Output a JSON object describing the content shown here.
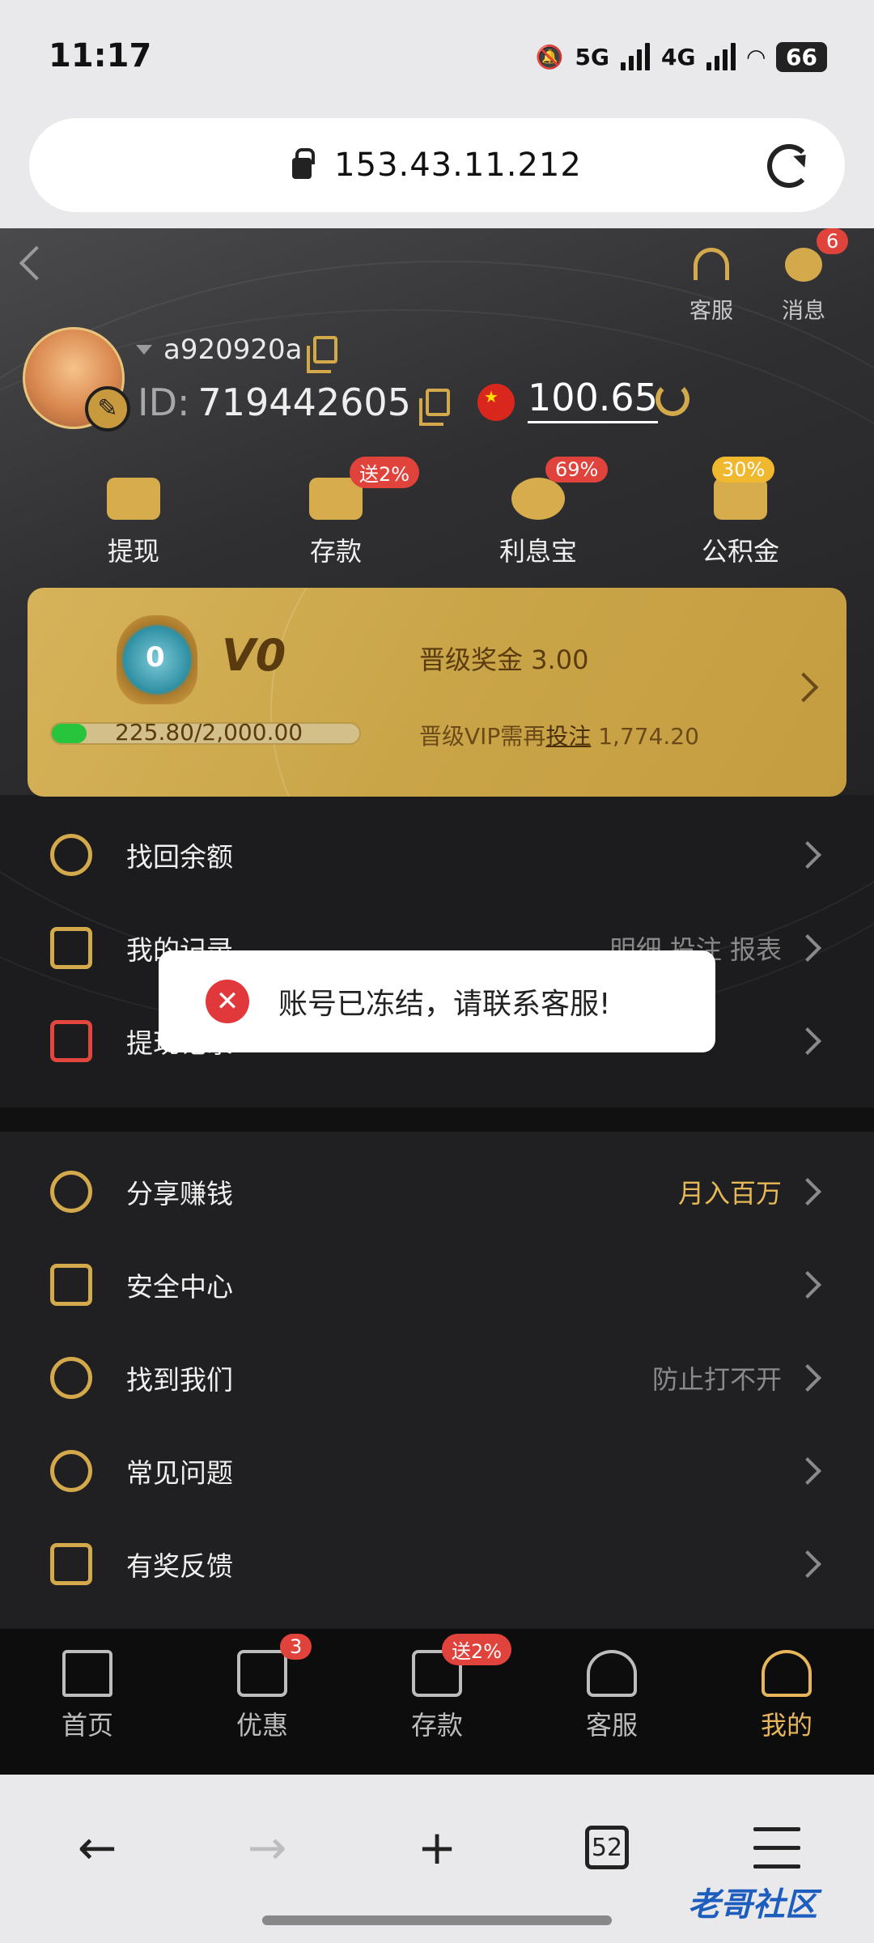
{
  "status_bar": {
    "time": "11:17",
    "net1": "5G",
    "net2": "4G",
    "battery": "66"
  },
  "browser": {
    "url": "153.43.11.212",
    "tab_count": "52",
    "watermark": "老哥社区"
  },
  "header": {
    "service_label": "客服",
    "message_label": "消息",
    "message_badge": "6"
  },
  "profile": {
    "username": "a920920a",
    "id_label": "ID:",
    "id_value": "719442605",
    "balance": "100.65"
  },
  "actions": [
    {
      "label": "提现",
      "badge": ""
    },
    {
      "label": "存款",
      "badge": "送2%"
    },
    {
      "label": "利息宝",
      "badge": "69%"
    },
    {
      "label": "公积金",
      "badge": "30%"
    }
  ],
  "vip": {
    "level": "V0",
    "medal_number": "0",
    "bonus_text": "晋级奖金 3.00",
    "progress_text": "225.80/2,000.00",
    "progress_fraction": 0.1129,
    "need_prefix": "晋级VIP需再",
    "need_link": "投注",
    "need_amount": "1,774.20"
  },
  "menu1": [
    {
      "label": "找回余额",
      "right": ""
    },
    {
      "label": "我的记录",
      "right": "明细   投注   报表"
    },
    {
      "label": "提现记录",
      "right": ""
    }
  ],
  "menu2": [
    {
      "label": "分享赚钱",
      "right": "月入百万"
    },
    {
      "label": "安全中心",
      "right": ""
    },
    {
      "label": "找到我们",
      "right": "防止打不开"
    },
    {
      "label": "常见问题",
      "right": ""
    },
    {
      "label": "有奖反馈",
      "right": ""
    }
  ],
  "toast": {
    "message": "账号已冻结，请联系客服!"
  },
  "tabs": [
    {
      "label": "首页",
      "badge": ""
    },
    {
      "label": "优惠",
      "badge": "3"
    },
    {
      "label": "存款",
      "badge": "送2%"
    },
    {
      "label": "客服",
      "badge": ""
    },
    {
      "label": "我的",
      "badge": ""
    }
  ],
  "colors": {
    "gold": "#d3a94c",
    "badge_red": "#e0433b",
    "vip_card": "#cba649",
    "page_bg": "#1c1c1e"
  }
}
